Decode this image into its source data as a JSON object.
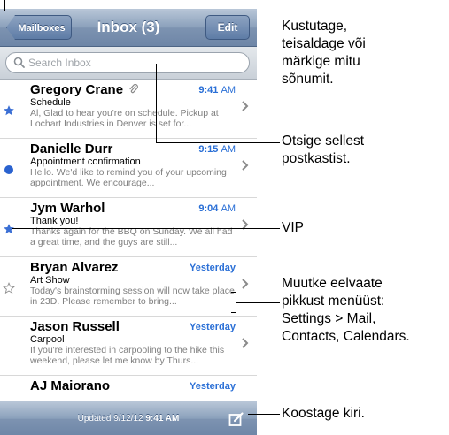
{
  "navbar": {
    "back_label": "Mailboxes",
    "title": "Inbox (3)",
    "edit_label": "Edit"
  },
  "search": {
    "placeholder": "Search Inbox"
  },
  "messages": [
    {
      "sender": "Gregory Crane",
      "time": "9:41",
      "ampm": "AM",
      "subject": "Schedule",
      "preview": "Al, Glad to hear you're on schedule. Pickup at Lochart Industries in Denver is set for...",
      "indicator": "star",
      "attachment": true
    },
    {
      "sender": "Danielle Durr",
      "time": "9:15",
      "ampm": "AM",
      "subject": "Appointment confirmation",
      "preview": "Hello. We'd like to remind you of your upcoming appointment. We encourage...",
      "indicator": "unread"
    },
    {
      "sender": "Jym Warhol",
      "time": "9:04",
      "ampm": "AM",
      "subject": "Thank you!",
      "preview": "Thanks again for the BBQ on Sunday. We all had a great time, and the guys are still...",
      "indicator": "star"
    },
    {
      "sender": "Bryan Alvarez",
      "time": "Yesterday",
      "ampm": "",
      "subject": "Art Show",
      "preview": "Today's brainstorming session will now take place in 23D. Please remember to bring...",
      "indicator": "star-outline"
    },
    {
      "sender": "Jason Russell",
      "time": "Yesterday",
      "ampm": "",
      "subject": "Carpool",
      "preview": "If you're interested in carpooling to the hike this weekend, please let me know by Thurs...",
      "indicator": "none"
    },
    {
      "sender": "AJ Maiorano",
      "time": "Yesterday",
      "ampm": "",
      "subject": "",
      "preview": "",
      "indicator": "none"
    }
  ],
  "toolbar": {
    "updated_label": "Updated",
    "updated_date": "9/12/12",
    "updated_time": "9:41 AM"
  },
  "callouts": {
    "edit": [
      "Kustutage,",
      "teisaldage või",
      "märkige mitu",
      "sõnumit."
    ],
    "search": [
      "Otsige sellest",
      "postkastist."
    ],
    "vip": [
      "VIP"
    ],
    "preview": [
      "Muutke eelvaate",
      "pikkust menüüst:",
      "Settings > Mail,",
      "Contacts, Calendars."
    ],
    "compose": [
      "Koostage kiri."
    ]
  },
  "colors": {
    "star": "#3b6fd4",
    "unread_dot": "#2a62cf",
    "time_blue": "#2a6fd6"
  }
}
